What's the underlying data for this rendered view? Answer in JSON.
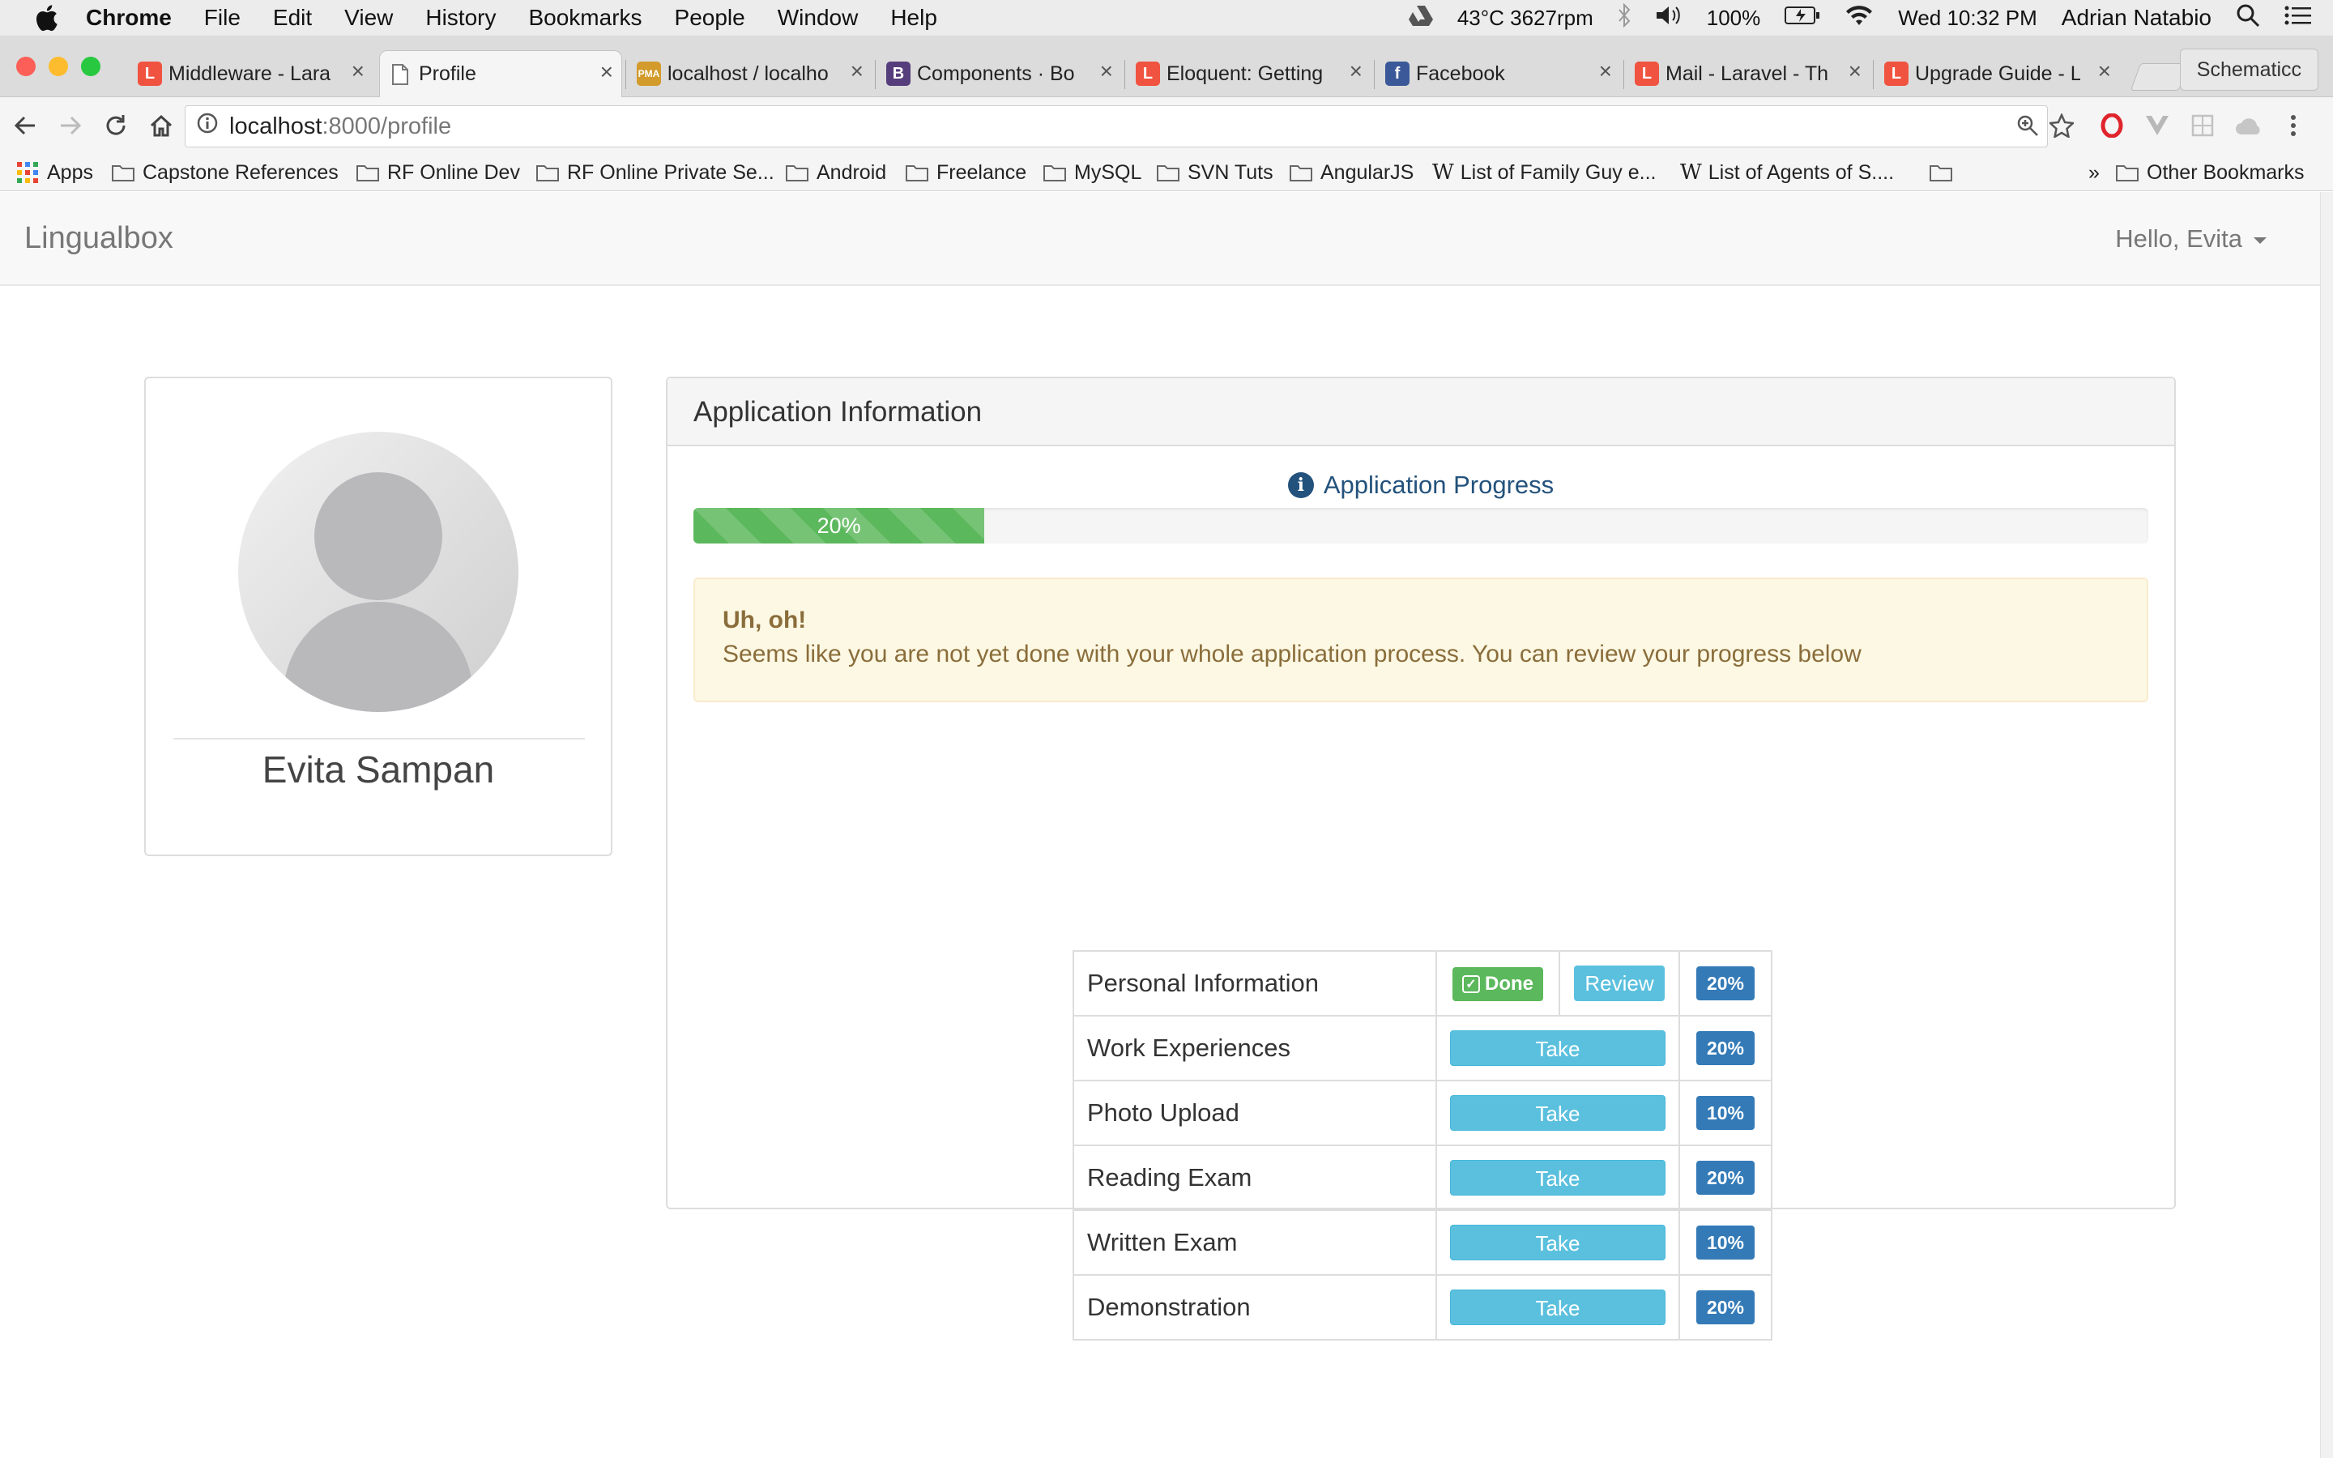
{
  "menubar": {
    "app_name": "Chrome",
    "items": [
      "File",
      "Edit",
      "View",
      "History",
      "Bookmarks",
      "People",
      "Window",
      "Help"
    ],
    "status": {
      "temp_fan": "43°C 3627rpm",
      "battery": "100%",
      "clock": "Wed 10:32 PM",
      "user": "Adrian Natabio"
    }
  },
  "tabs": [
    {
      "label": "Middleware - Lara",
      "favicon": "laravel-icon",
      "color": "#f05340"
    },
    {
      "label": "Profile",
      "favicon": "page-icon",
      "color": "#888888",
      "active": true
    },
    {
      "label": "localhost / localho",
      "favicon": "phpmyadmin-icon",
      "color": "#d29b2b"
    },
    {
      "label": "Components · Bo",
      "favicon": "bootstrap-icon",
      "color": "#563d7c"
    },
    {
      "label": "Eloquent: Getting",
      "favicon": "laravel-icon",
      "color": "#f05340"
    },
    {
      "label": "Facebook",
      "favicon": "facebook-icon",
      "color": "#3b5998"
    },
    {
      "label": "Mail - Laravel - Th",
      "favicon": "laravel-icon",
      "color": "#f05340"
    },
    {
      "label": "Upgrade Guide - L",
      "favicon": "laravel-icon",
      "color": "#f05340"
    }
  ],
  "profile_button": "Schematicc",
  "address": {
    "host": "localhost",
    "path": ":8000/profile"
  },
  "bookmarks": {
    "apps": "Apps",
    "items": [
      "Capstone References",
      "RF Online Dev",
      "RF Online Private Se...",
      "Android",
      "Freelance",
      "MySQL",
      "SVN Tuts",
      "AngularJS"
    ],
    "wiki_items": [
      "List of Family Guy e...",
      "List of Agents of S...."
    ],
    "overflow": "»",
    "other": "Other Bookmarks"
  },
  "navbar": {
    "brand": "Lingualbox",
    "greeting": "Hello, Evita"
  },
  "profile": {
    "name": "Evita Sampan"
  },
  "panel": {
    "title": "Application Information",
    "progress_title": "Application Progress",
    "progress_percent": 20,
    "progress_label": "20%",
    "alert_title": "Uh, oh!",
    "alert_text": "Seems like you are not yet done with your whole application process. You can review your progress below"
  },
  "steps": [
    {
      "name": "Personal Information",
      "status": "done",
      "done_label": "Done",
      "review_label": "Review",
      "weight": "20%"
    },
    {
      "name": "Work Experiences",
      "status": "take",
      "take_label": "Take",
      "weight": "20%"
    },
    {
      "name": "Photo Upload",
      "status": "take",
      "take_label": "Take",
      "weight": "10%"
    },
    {
      "name": "Reading Exam",
      "status": "take",
      "take_label": "Take",
      "weight": "20%"
    },
    {
      "name": "Written Exam",
      "status": "take",
      "take_label": "Take",
      "weight": "10%"
    },
    {
      "name": "Demonstration",
      "status": "take",
      "take_label": "Take",
      "weight": "20%"
    }
  ]
}
